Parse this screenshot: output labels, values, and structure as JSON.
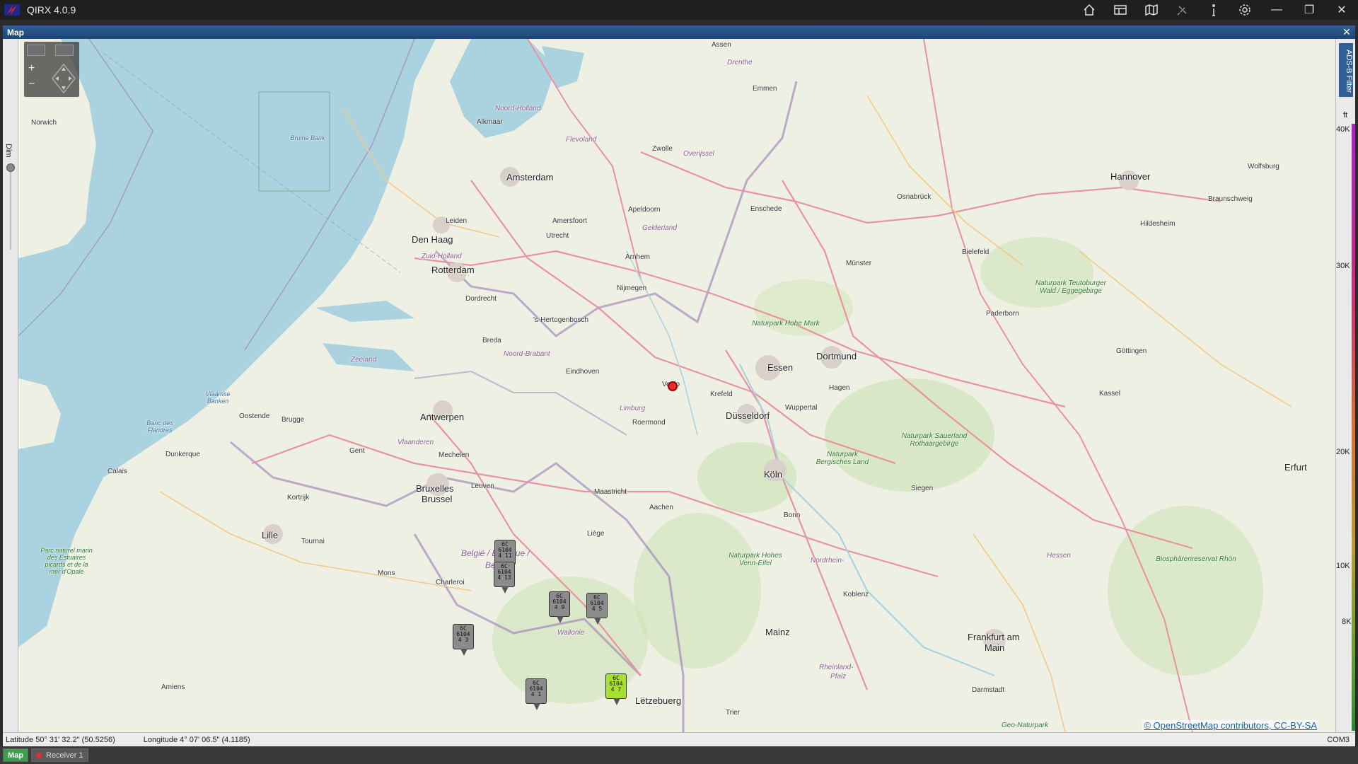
{
  "window": {
    "title": "QIRX 4.0.9"
  },
  "panel": {
    "title": "Map"
  },
  "sidebar": {
    "dim_label": "Dim"
  },
  "right_panel": {
    "filter_tab": "ADS-B Filter",
    "unit": "ft",
    "ticks": [
      "40K",
      "30K",
      "20K",
      "10K",
      "8K"
    ]
  },
  "map": {
    "attribution": "© OpenStreetMap contributors, CC-BY-SA",
    "places": {
      "amsterdam": "Amsterdam",
      "den_haag": "Den Haag",
      "rotterdam": "Rotterdam",
      "antwerpen": "Antwerpen",
      "bruxelles": "Bruxelles",
      "brussel": "Brussel",
      "lille": "Lille",
      "essen": "Essen",
      "dortmund": "Dortmund",
      "dusseldorf": "Düsseldorf",
      "koln": "Köln",
      "hannover": "Hannover",
      "frankfurt": "Frankfurt am",
      "frankfurt2": "Main",
      "letzebuerg": "Lëtzebuerg",
      "erfurt": "Erfurt",
      "kassel": "Kassel",
      "eindhoven": "Eindhoven",
      "utrecht": "Utrecht",
      "arnhem": "Arnhem",
      "nijmegen": "Nijmegen",
      "breda": "Breda",
      "gent": "Gent",
      "brugge": "Brugge",
      "oostende": "Oostende",
      "dunkerque": "Dunkerque",
      "calais": "Calais",
      "norwich": "Norwich",
      "mons": "Mons",
      "charleroi": "Charleroi",
      "liege": "Liège",
      "maastricht": "Maastricht",
      "aachen": "Aachen",
      "bonn": "Bonn",
      "koblenz": "Koblenz",
      "mainz": "Mainz",
      "darmstadt": "Darmstadt",
      "trier": "Trier",
      "siegen": "Siegen",
      "hagen": "Hagen",
      "munster": "Münster",
      "osnabruck": "Osnabrück",
      "bielefeld": "Bielefeld",
      "paderborn": "Paderborn",
      "enschede": "Enschede",
      "zwolle": "Zwolle",
      "apeldoorn": "Apeldoorn",
      "amersfoort": "Amersfoort",
      "alkmaar": "Alkmaar",
      "leiden": "Leiden",
      "dordrecht": "Dordrecht",
      "hertogenbosch": "'s-Hertogenbosch",
      "venlo": "Venlo",
      "roermond": "Roermond",
      "krefeld": "Krefeld",
      "wuppertal": "Wuppertal",
      "mechelen": "Mechelen",
      "leuven": "Leuven",
      "kortrijk": "Kortrijk",
      "tournai": "Tournai",
      "amiens": "Amiens",
      "emmen": "Emmen",
      "assen": "Assen",
      "wolfsburg": "Wolfsburg",
      "braunschweig": "Braunschweig",
      "hildesheim": "Hildesheim",
      "gottingen": "Göttingen",
      "belgie": "België / Belgique /",
      "belgien": "Belgien",
      "wallonie": "Wallonie",
      "vlaanderen": "Vlaanderen",
      "nrw": "Nordrhein-",
      "rheinland": "Rheinland-",
      "pfalz": "Pfalz",
      "hessen": "Hessen",
      "limburg": "Limburg",
      "noord_brabant": "Noord-Brabant",
      "gelderland": "Gelderland",
      "zeeland": "Zeeland",
      "zuid_holland": "Zuid-Holland",
      "noord_holland": "Noord-Holland",
      "flevoland": "Flevoland",
      "overijssel": "Overijssel",
      "drenthe": "Drenthe",
      "np_hohe_mark": "Naturpark Hohe Mark",
      "np_sauerland": "Naturpark Sauerland Rothaargebirge",
      "np_bergisches": "Naturpark Bergisches Land",
      "np_teutoburger": "Naturpark Teutoburger Wald / Eggegebirge",
      "np_hohes_venn": "Naturpark Hohes Venn-Eifel",
      "biosphere_rhon": "Biosphärenreservat Rhön",
      "geo_naturpark": "Geo-Naturpark",
      "bruine_bank": "Bruine Bank",
      "vlaamse_banken": "Vlaamse Banken",
      "banc_flandres": "Banc des Flandres",
      "parc_opale": "Parc naturel marin des Estuaires picards et de la mer d'Opale"
    },
    "aircraft": [
      {
        "line1": "6C",
        "line2": "6104",
        "line3": "4 11"
      },
      {
        "line1": "6C",
        "line2": "6104",
        "line3": "4 13"
      },
      {
        "line1": "6C",
        "line2": "6104",
        "line3": "4 9"
      },
      {
        "line1": "6C",
        "line2": "6104",
        "line3": "4 5"
      },
      {
        "line1": "6C",
        "line2": "6104",
        "line3": "4 3"
      },
      {
        "line1": "6C",
        "line2": "6104",
        "line3": "4 1"
      },
      {
        "line1": "6C",
        "line2": "6104",
        "line3": "4 7"
      }
    ]
  },
  "status": {
    "latitude": "Latitude  50° 31' 32.2\" (50.5256)",
    "longitude": "Longitude  4° 07' 06.5\" (4.1185)",
    "port": "COM3"
  },
  "tabs": [
    {
      "label": "Map"
    },
    {
      "label": "Receiver 1"
    }
  ],
  "colors": {
    "sea": "#aad3df",
    "land": "#eef0e4",
    "accent": "#2f5f94",
    "active_tab": "#3aa04a"
  }
}
